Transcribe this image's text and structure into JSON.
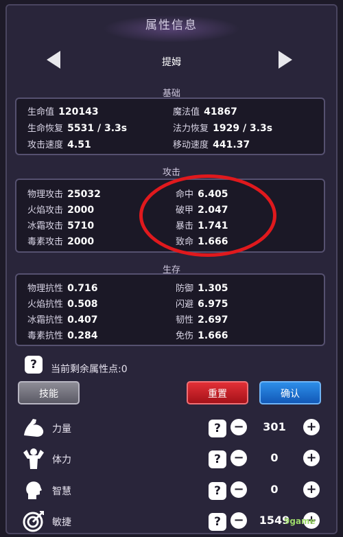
{
  "title": "属性信息",
  "hero_name": "提姆",
  "sections": {
    "base": "基础",
    "attack": "攻击",
    "survival": "生存"
  },
  "base_stats": [
    {
      "label": "生命值",
      "value": "120143"
    },
    {
      "label": "魔法值",
      "value": "41867"
    },
    {
      "label": "生命恢复",
      "value": "5531 / 3.3s"
    },
    {
      "label": "法力恢复",
      "value": "1929 / 3.3s"
    },
    {
      "label": "攻击速度",
      "value": "4.51"
    },
    {
      "label": "移动速度",
      "value": "441.37"
    }
  ],
  "attack_stats": [
    {
      "label": "物理攻击",
      "value": "25032"
    },
    {
      "label": "命中",
      "value": "6.405"
    },
    {
      "label": "火焰攻击",
      "value": "2000"
    },
    {
      "label": "破甲",
      "value": "2.047"
    },
    {
      "label": "冰霜攻击",
      "value": "5710"
    },
    {
      "label": "暴击",
      "value": "1.741"
    },
    {
      "label": "毒素攻击",
      "value": "2000"
    },
    {
      "label": "致命",
      "value": "1.666"
    }
  ],
  "survival_stats": [
    {
      "label": "物理抗性",
      "value": "0.716"
    },
    {
      "label": "防御",
      "value": "1.305"
    },
    {
      "label": "火焰抗性",
      "value": "0.508"
    },
    {
      "label": "闪避",
      "value": "6.975"
    },
    {
      "label": "冰霜抗性",
      "value": "0.407"
    },
    {
      "label": "韧性",
      "value": "2.697"
    },
    {
      "label": "毒素抗性",
      "value": "0.284"
    },
    {
      "label": "免伤",
      "value": "1.666"
    }
  ],
  "help_glyph": "?",
  "remaining_points": "当前剩余属性点:0",
  "buttons": {
    "skill": "技能",
    "reset": "重置",
    "confirm": "确认"
  },
  "attributes": [
    {
      "name": "力量",
      "value": "301",
      "icon": "arm-muscle-icon"
    },
    {
      "name": "体力",
      "value": "0",
      "icon": "bodybuilder-icon"
    },
    {
      "name": "智慧",
      "value": "0",
      "icon": "head-icon"
    },
    {
      "name": "敏捷",
      "value": "1549",
      "icon": "target-icon"
    }
  ],
  "minus_glyph": "−",
  "plus_glyph": "+",
  "watermark": "9game",
  "colors": {
    "reset_button": "#d11f26",
    "confirm_button": "#1f74d6",
    "highlight_circle": "#e0191d"
  }
}
